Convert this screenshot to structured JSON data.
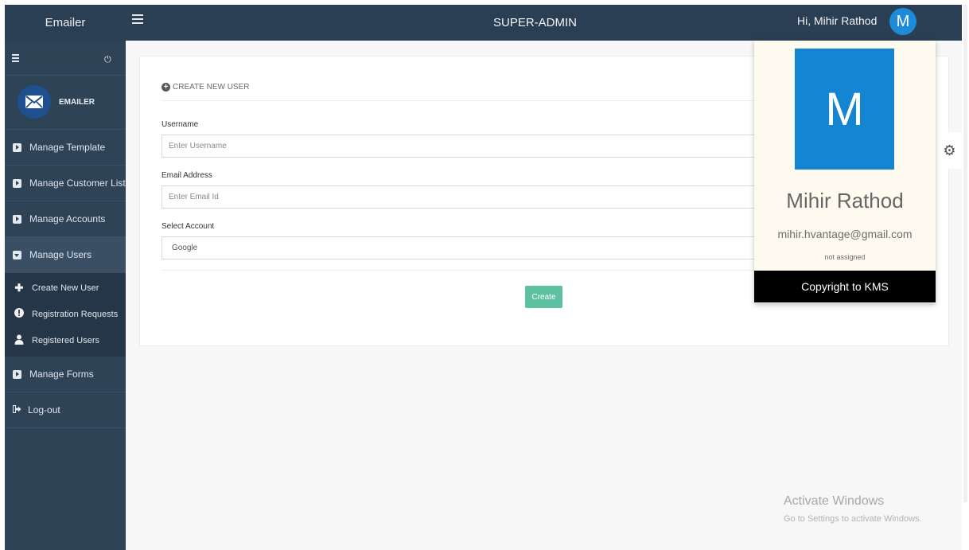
{
  "topbar": {
    "brand": "Emailer",
    "title": "SUPER-ADMIN",
    "greeting": "Hi, Mihir Rathod",
    "avatar_letter": "M"
  },
  "sidebar": {
    "logo_text": "EMAILER",
    "items": [
      {
        "label": "Manage Template"
      },
      {
        "label": "Manage Customer List"
      },
      {
        "label": "Manage Accounts"
      },
      {
        "label": "Manage Users"
      },
      {
        "label": "Manage Forms"
      },
      {
        "label": "Log-out"
      }
    ],
    "subitems": [
      {
        "label": "Create New User",
        "icon": "plus-icon"
      },
      {
        "label": "Registration Requests",
        "icon": "exclamation-icon"
      },
      {
        "label": "Registered Users",
        "icon": "user-icon"
      }
    ]
  },
  "form": {
    "heading": "CREATE NEW USER",
    "username_label": "Username",
    "username_placeholder": "Enter Username",
    "email_label": "Email Address",
    "email_placeholder": "Enter Email Id",
    "account_label": "Select Account",
    "account_value": "Google",
    "create_label": "Create"
  },
  "profile": {
    "letter": "M",
    "name": "Mihir Rathod",
    "email": "mihir.hvantage@gmail.com",
    "status": "not assigned",
    "footer": "Copyright to KMS"
  },
  "watermark": {
    "title": "Activate Windows",
    "subtitle": "Go to Settings to activate Windows."
  },
  "colors": {
    "topbar": "#2a3f54",
    "sidebar": "#2f4357",
    "accent_button": "#5dc0a0",
    "avatar": "#1486d1"
  }
}
